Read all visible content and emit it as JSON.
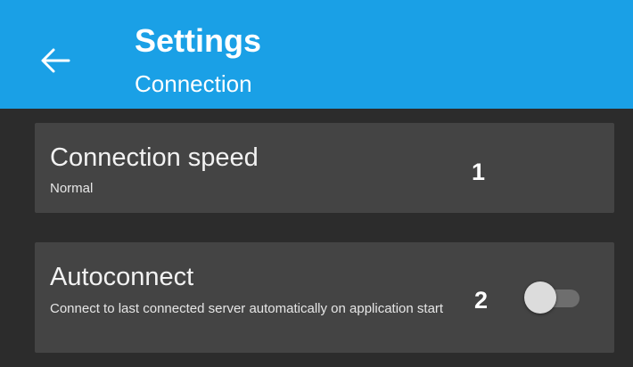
{
  "header": {
    "title": "Settings",
    "subtitle": "Connection",
    "back_icon": "arrow-left-icon",
    "background_color": "#1aa0e6"
  },
  "settings": [
    {
      "title": "Connection speed",
      "description": "Normal",
      "marker": "1"
    },
    {
      "title": "Autoconnect",
      "description": "Connect to last connected server automatically on application start",
      "marker": "2",
      "toggle": {
        "state": "off",
        "icon": "toggle-switch-icon"
      }
    }
  ],
  "colors": {
    "background": "#2c2c2c",
    "card": "#444444",
    "text": "#ffffff"
  }
}
